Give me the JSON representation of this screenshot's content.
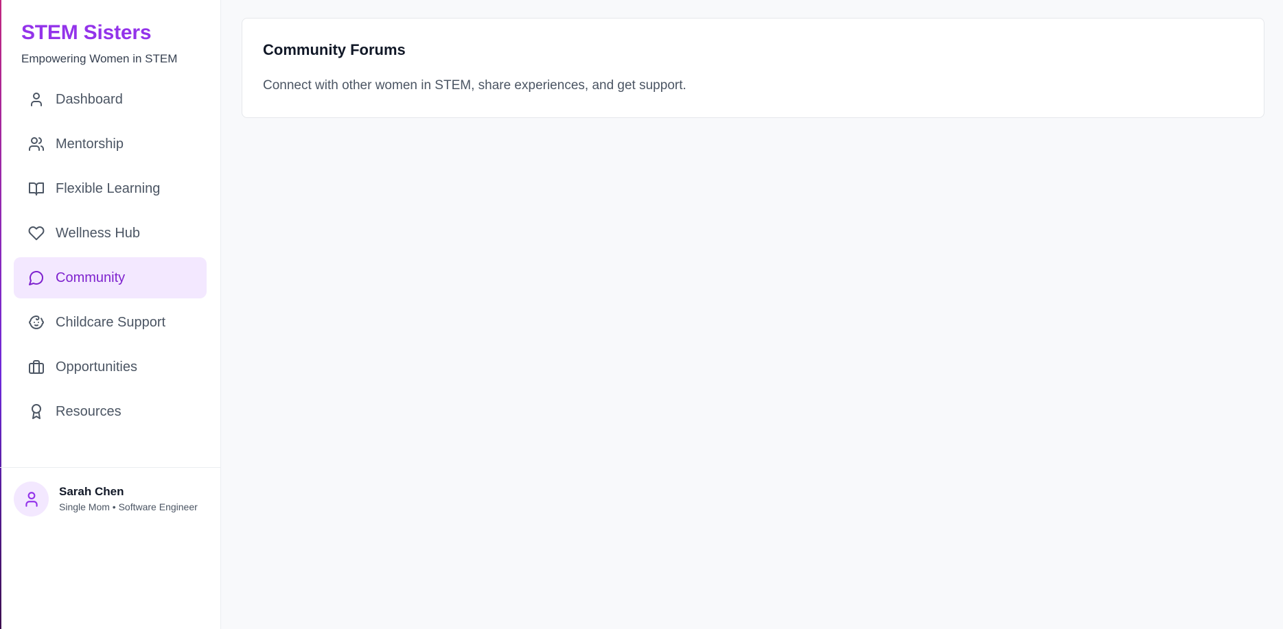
{
  "brand": {
    "title": "STEM Sisters",
    "subtitle": "Empowering Women in STEM",
    "accent_color": "#9333ea"
  },
  "sidebar": {
    "items": [
      {
        "label": "Dashboard",
        "icon": "user-icon",
        "active": false
      },
      {
        "label": "Mentorship",
        "icon": "users-icon",
        "active": false
      },
      {
        "label": "Flexible Learning",
        "icon": "book-open-icon",
        "active": false
      },
      {
        "label": "Wellness Hub",
        "icon": "heart-icon",
        "active": false
      },
      {
        "label": "Community",
        "icon": "message-circle-icon",
        "active": true
      },
      {
        "label": "Childcare Support",
        "icon": "baby-icon",
        "active": false
      },
      {
        "label": "Opportunities",
        "icon": "briefcase-icon",
        "active": false
      },
      {
        "label": "Resources",
        "icon": "award-icon",
        "active": false
      }
    ],
    "active_bg": "#f3e8ff",
    "active_color": "#7e22ce"
  },
  "user": {
    "name": "Sarah Chen",
    "role": "Single Mom • Software Engineer",
    "avatar_icon": "user-icon"
  },
  "main": {
    "card": {
      "title": "Community Forums",
      "description": "Connect with other women in STEM, share experiences, and get support."
    }
  }
}
